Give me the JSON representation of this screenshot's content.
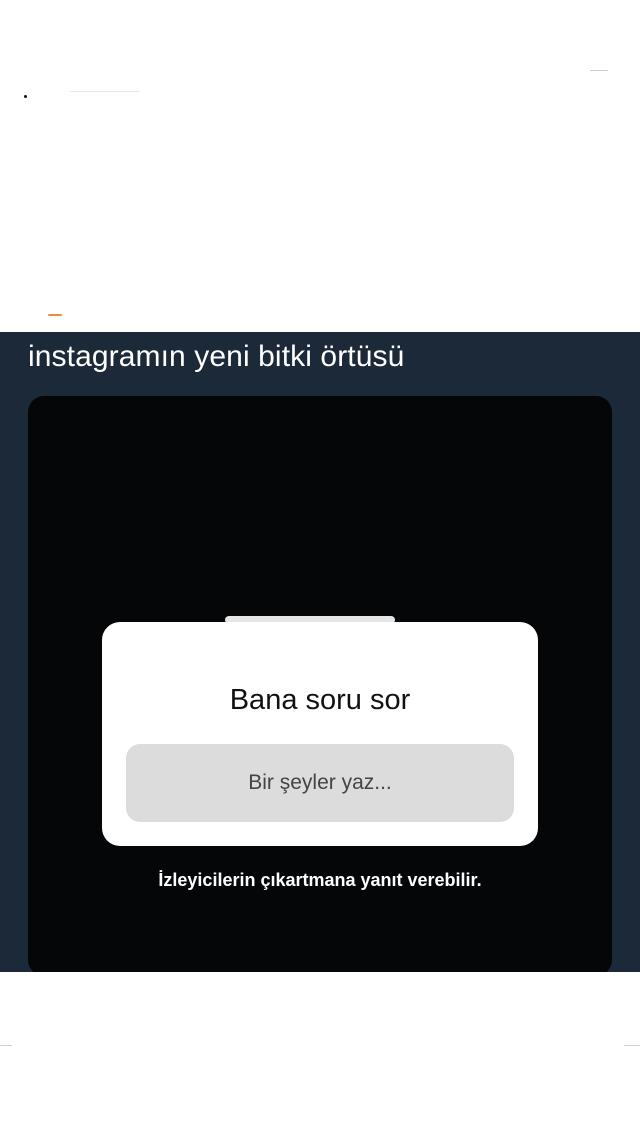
{
  "tweet": {
    "text": "instagramın yeni bitki örtüsü"
  },
  "story": {
    "sticker_title": "Bana soru sor",
    "input_placeholder": "Bir şeyler yaz...",
    "hint": "İzleyicilerin çıkartmana yanıt verebilir."
  },
  "colors": {
    "tweet_background": "#1c2938",
    "story_background": "#050607",
    "sticker_background": "#ffffff",
    "input_background": "#dcdcdc"
  }
}
